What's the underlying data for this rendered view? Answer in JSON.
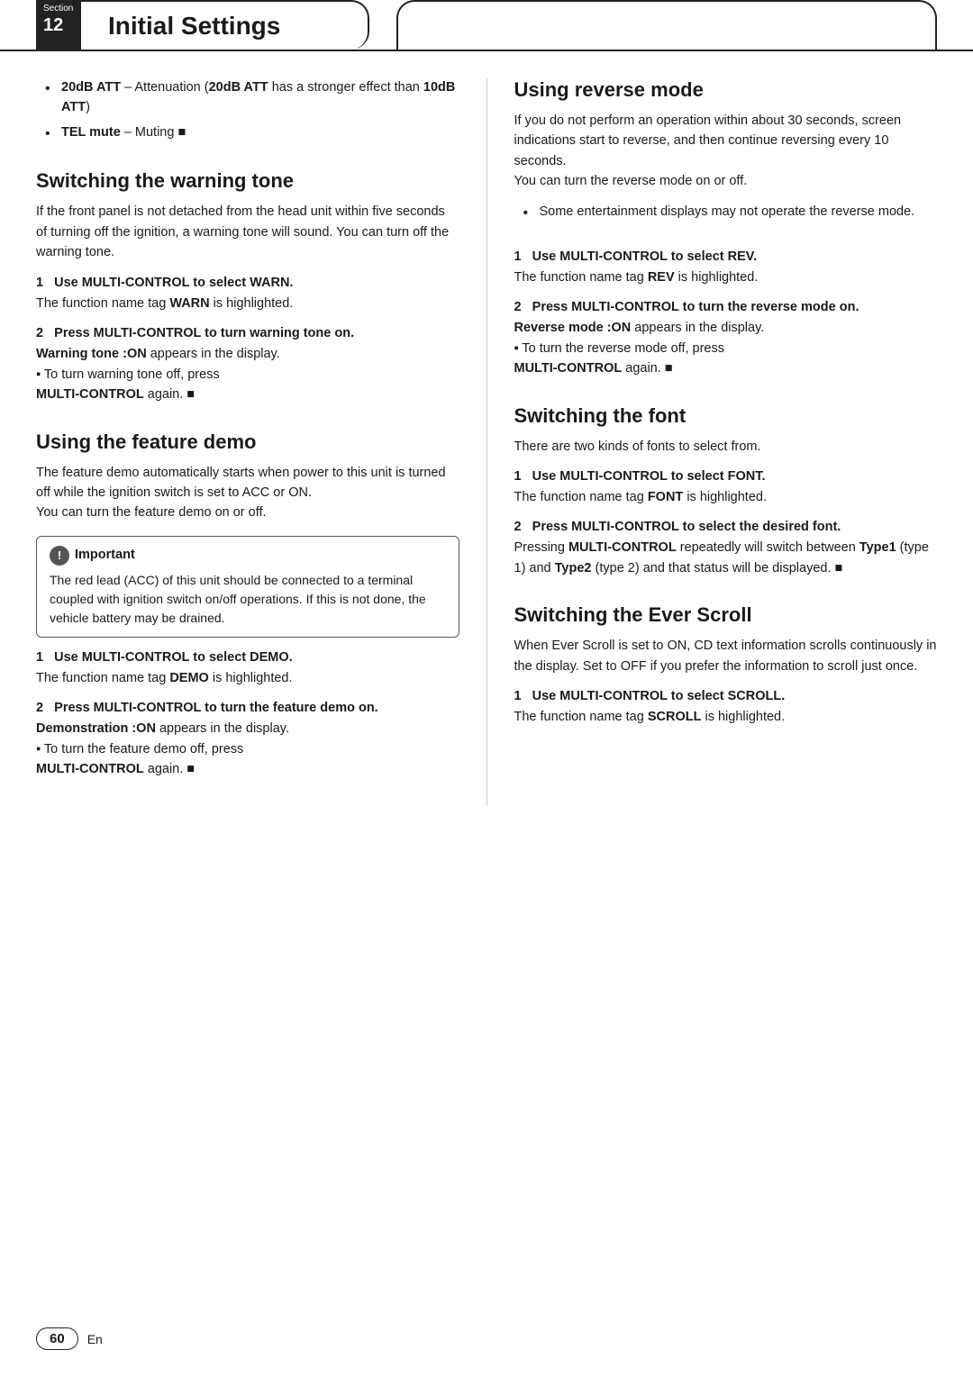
{
  "header": {
    "section_label": "Section",
    "section_number": "12",
    "title": "Initial Settings",
    "right_box": ""
  },
  "footer": {
    "page_number": "60",
    "language": "En"
  },
  "left_col": {
    "intro_bullets": [
      {
        "html": "<strong>20dB ATT</strong> – Attenuation (<strong>20dB ATT</strong> has a stronger effect than <strong>10dB ATT</strong>)"
      },
      {
        "html": "<strong>TEL mute</strong> – Muting ■"
      }
    ],
    "sections": [
      {
        "id": "switching-warning-tone",
        "heading": "Switching the warning tone",
        "body": "If the front panel is not detached from the head unit within five seconds of turning off the ignition, a warning tone will sound. You can turn off the warning tone.",
        "steps": [
          {
            "number": "1",
            "heading": "Use MULTI-CONTROL to select WARN.",
            "body": "The function name tag <strong>WARN</strong> is highlighted."
          },
          {
            "number": "2",
            "heading": "Press MULTI-CONTROL to turn warning tone on.",
            "body_parts": [
              "<strong>Warning tone :ON</strong> appears in the display.",
              "▪ To turn warning tone off, press",
              "<strong>MULTI-CONTROL</strong> again. ■"
            ]
          }
        ]
      },
      {
        "id": "using-feature-demo",
        "heading": "Using the feature demo",
        "body": "The feature demo automatically starts when power to this unit is turned off while the ignition switch is set to ACC or ON.\nYou can turn the feature demo on or off.",
        "important": {
          "label": "Important",
          "text": "The red lead (ACC) of this unit should be connected to a terminal coupled with ignition switch on/off operations. If this is not done, the vehicle battery may be drained."
        },
        "steps": [
          {
            "number": "1",
            "heading": "Use MULTI-CONTROL to select DEMO.",
            "body": "The function name tag <strong>DEMO</strong> is highlighted."
          },
          {
            "number": "2",
            "heading": "Press MULTI-CONTROL to turn the feature demo on.",
            "body_parts": [
              "<strong>Demonstration :ON</strong> appears in the display.",
              "▪ To turn the feature demo off, press",
              "<strong>MULTI-CONTROL</strong> again. ■"
            ]
          }
        ]
      }
    ]
  },
  "right_col": {
    "sections": [
      {
        "id": "using-reverse-mode",
        "heading": "Using reverse mode",
        "body": "If you do not perform an operation within about 30 seconds, screen indications start to reverse, and then continue reversing every 10 seconds.\nYou can turn the reverse mode on or off.",
        "bullets": [
          "Some entertainment displays may not operate the reverse mode."
        ],
        "steps": [
          {
            "number": "1",
            "heading": "Use MULTI-CONTROL to select REV.",
            "body": "The function name tag <strong>REV</strong> is highlighted."
          },
          {
            "number": "2",
            "heading": "Press MULTI-CONTROL to turn the reverse mode on.",
            "body_parts": [
              "<strong>Reverse mode :ON</strong> appears in the display.",
              "▪ To turn the reverse mode off, press",
              "<strong>MULTI-CONTROL</strong> again. ■"
            ]
          }
        ]
      },
      {
        "id": "switching-font",
        "heading": "Switching the font",
        "body": "There are two kinds of fonts to select from.",
        "steps": [
          {
            "number": "1",
            "heading": "Use MULTI-CONTROL to select FONT.",
            "body": "The function name tag <strong>FONT</strong> is highlighted."
          },
          {
            "number": "2",
            "heading": "Press MULTI-CONTROL to select the desired font.",
            "body_parts": [
              "Pressing <strong>MULTI-CONTROL</strong> repeatedly will switch between <strong>Type1</strong> (type 1) and <strong>Type2</strong> (type 2) and that status will be displayed. ■"
            ]
          }
        ]
      },
      {
        "id": "switching-ever-scroll",
        "heading": "Switching the Ever Scroll",
        "body": "When Ever Scroll is set to ON, CD text information scrolls continuously in the display. Set to OFF if you prefer the information to scroll just once.",
        "steps": [
          {
            "number": "1",
            "heading": "Use MULTI-CONTROL to select SCROLL.",
            "body": "The function name tag <strong>SCROLL</strong> is highlighted."
          }
        ]
      }
    ]
  }
}
